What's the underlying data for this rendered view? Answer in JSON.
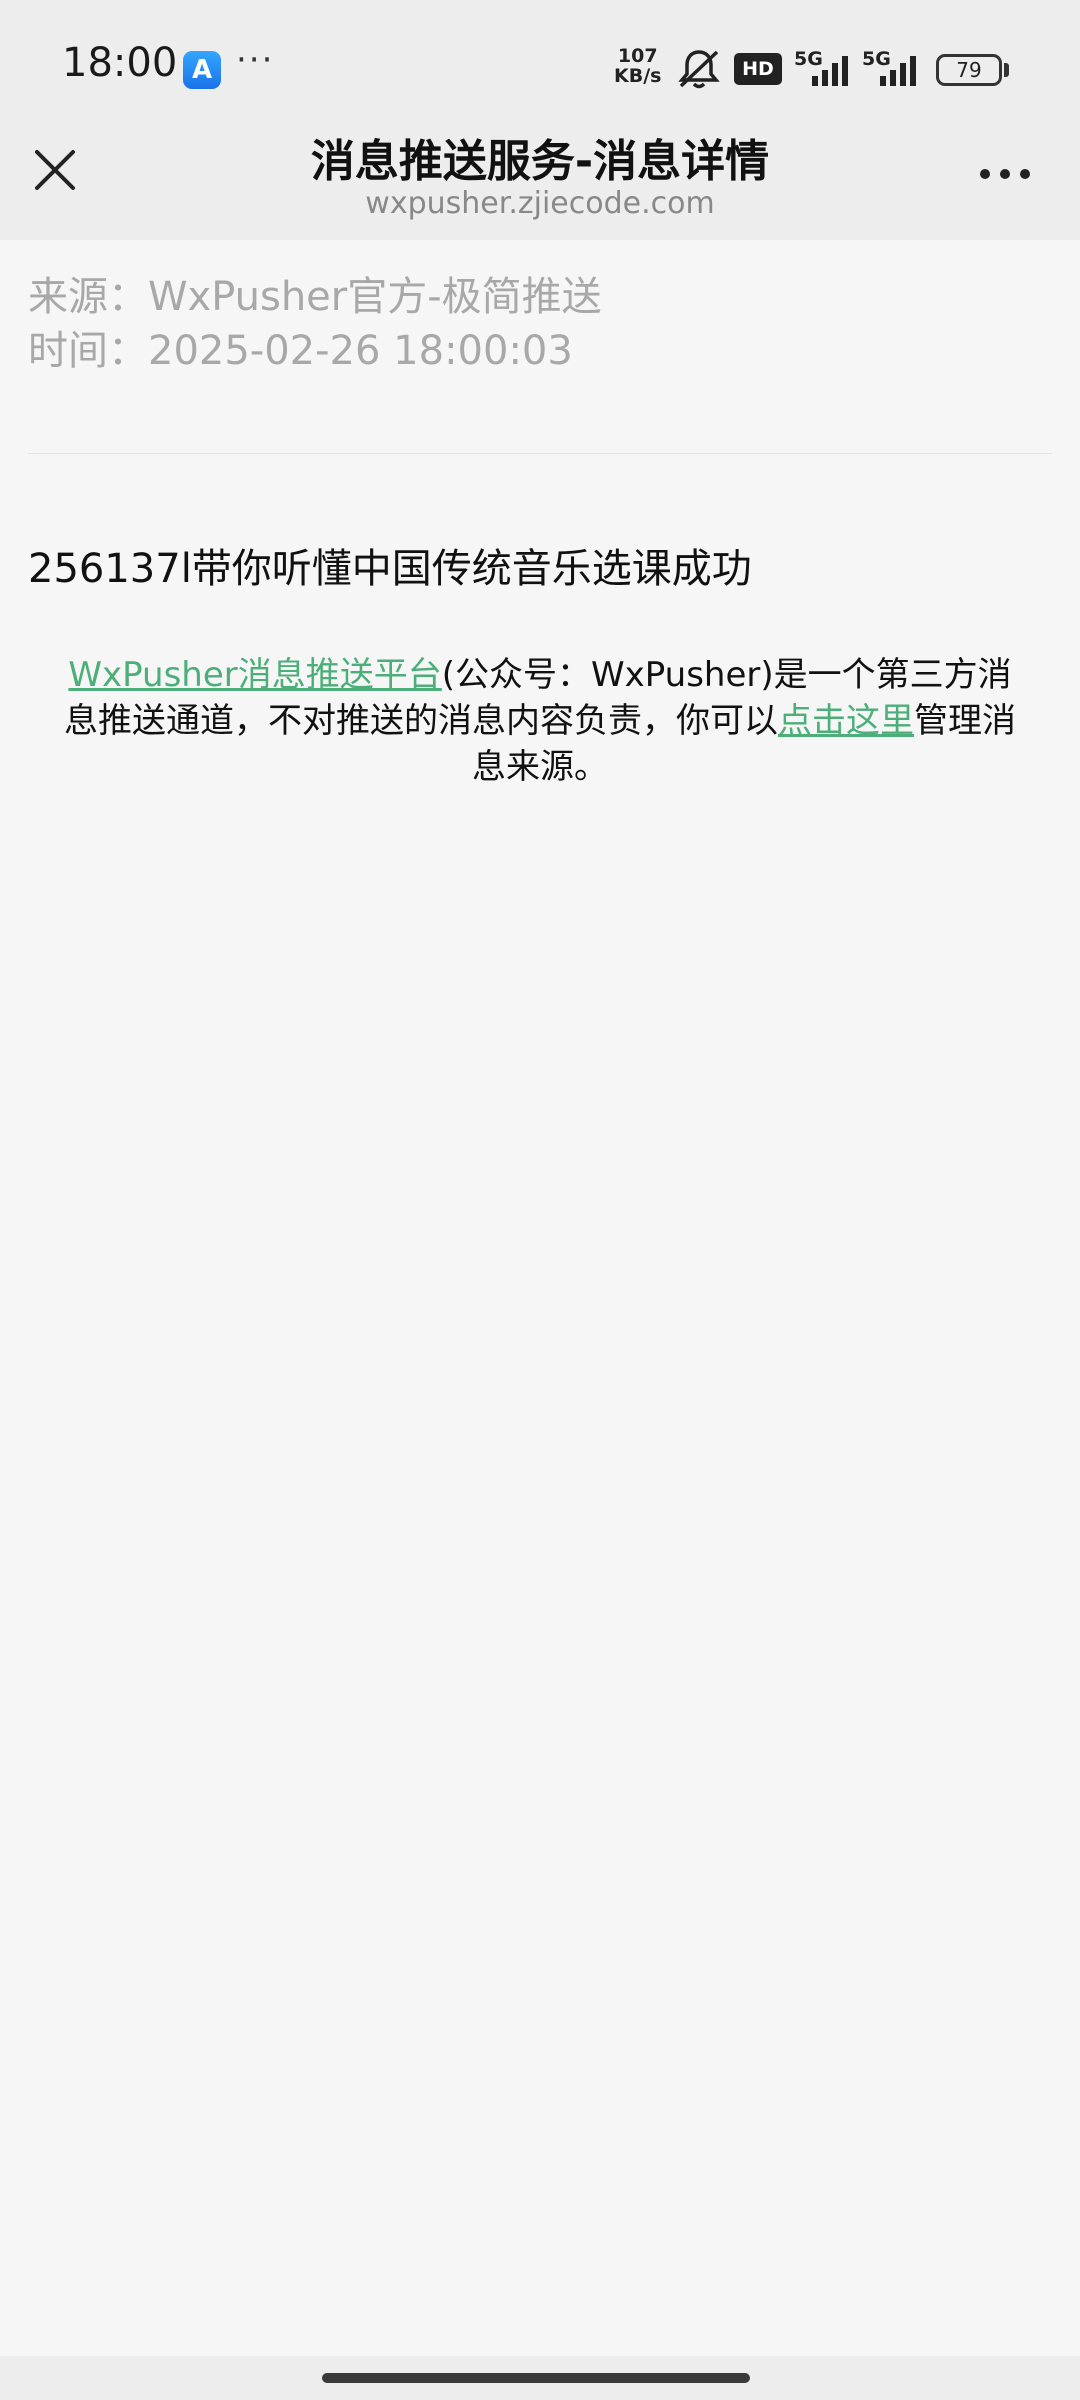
{
  "status_bar": {
    "time": "18:00",
    "store_glyph": "A",
    "more": "···",
    "net_speed_value": "107",
    "net_speed_unit": "KB/s",
    "hd": "HD",
    "sim1_label": "5G",
    "sim2_label": "5G",
    "battery": "79",
    "icons": [
      "app-store-icon",
      "muted-bell-icon",
      "hd-icon",
      "signal-icon",
      "signal-icon",
      "battery-icon"
    ]
  },
  "header": {
    "title": "消息推送服务-消息详情",
    "domain": "wxpusher.zjiecode.com",
    "close_icon": "close-icon",
    "menu_icon": "more-icon"
  },
  "message": {
    "source_line": "来源：WxPusher官方-极简推送",
    "time_line": "时间：2025-02-26 18:00:03",
    "title": "256137l带你听懂中国传统音乐选课成功"
  },
  "notice": {
    "link1": "WxPusher消息推送平台",
    "text1": "(公众号：WxPusher)是一个第三方消息推送通道，不对推送的消息内容负责，你可以",
    "link2": "点击这里",
    "text2": "管理消息来源。"
  },
  "colors": {
    "link": "#4caf7a",
    "meta_text": "#a8a8a8",
    "bar_bg": "#ededed",
    "page_bg": "#f6f6f6"
  }
}
